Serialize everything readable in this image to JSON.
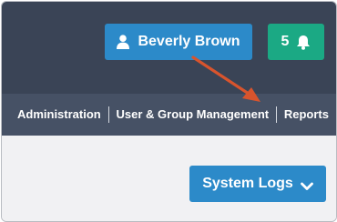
{
  "header": {
    "user_button": {
      "label": "Beverly Brown",
      "icon": "user-icon"
    },
    "notifications_button": {
      "count": "5",
      "icon": "bell-icon"
    }
  },
  "nav": {
    "items": [
      {
        "label": "Administration"
      },
      {
        "label": "User & Group Management"
      },
      {
        "label": "Reports"
      }
    ]
  },
  "content": {
    "system_logs_button": {
      "label": "System Logs",
      "icon": "chevron-down-icon"
    }
  },
  "annotation": {
    "icon": "arrow-pointer",
    "color": "#d8542d"
  },
  "colors": {
    "topbar": "#3a4456",
    "navbar": "#465165",
    "primary_button": "#2c8ac9",
    "success_button": "#1ba984"
  }
}
